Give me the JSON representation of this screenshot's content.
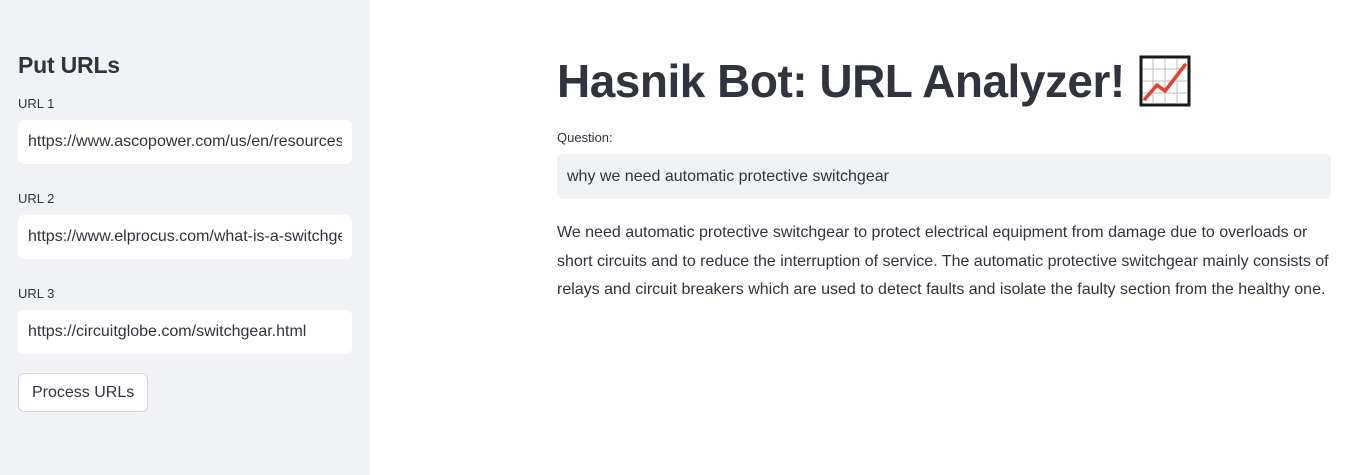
{
  "sidebar": {
    "title": "Put URLs",
    "fields": [
      {
        "label": "URL 1",
        "value": "https://www.ascopower.com/us/en/resources/articles/automatic-protective-switchgear"
      },
      {
        "label": "URL 2",
        "value": "https://www.elprocus.com/what-is-a-switchgear-types-and-its-working/"
      },
      {
        "label": "URL 3",
        "value": "https://circuitglobe.com/switchgear.html"
      }
    ],
    "process_button_label": "Process URLs"
  },
  "main": {
    "title": "Hasnik Bot: URL Analyzer!",
    "title_icon": "chart-increasing-icon",
    "question_label": "Question:",
    "question_value": "why we need automatic protective switchgear",
    "answer": "We need automatic protective switchgear to protect electrical equipment from damage due to overloads or short circuits and to reduce the interruption of service. The automatic protective switchgear mainly consists of relays and circuit breakers which are used to detect faults and isolate the faulty section from the healthy one."
  },
  "colors": {
    "sidebar_bg": "#f0f2f6",
    "text": "#31333f",
    "chart_line": "#e8402a"
  }
}
